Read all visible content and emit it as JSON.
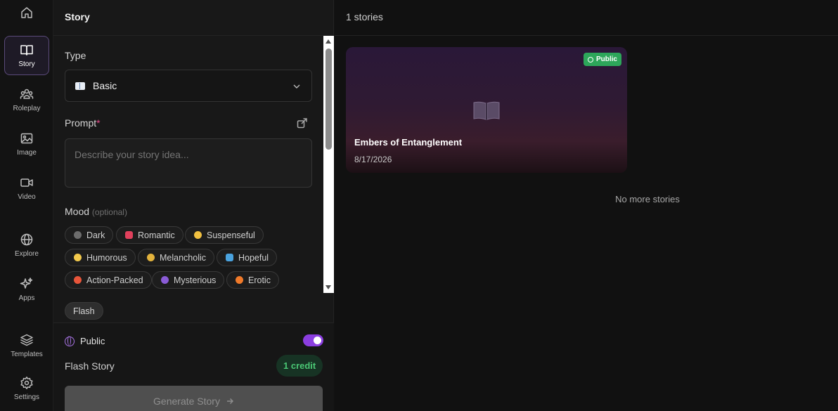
{
  "rail": {
    "items": [
      {
        "label": "Story"
      },
      {
        "label": "Roleplay"
      },
      {
        "label": "Image"
      },
      {
        "label": "Video"
      },
      {
        "label": "Explore"
      },
      {
        "label": "Apps"
      },
      {
        "label": "Templates"
      },
      {
        "label": "Settings"
      }
    ]
  },
  "panel": {
    "title": "Story",
    "type_label": "Type",
    "type_value": "Basic",
    "prompt_label": "Prompt",
    "prompt_required": "*",
    "prompt_placeholder": "Describe your story idea...",
    "mood_label": "Mood",
    "mood_optional": "(optional)",
    "moods": [
      "Dark",
      "Romantic",
      "Suspenseful",
      "Humorous",
      "Melancholic",
      "Hopeful",
      "Action-Packed",
      "Mysterious",
      "Erotic"
    ],
    "flash_chip": "Flash",
    "public_label": "Public",
    "public_on": true,
    "flash_story_label": "Flash Story",
    "credit": "1 credit",
    "generate_label": "Generate Story"
  },
  "main": {
    "count": "1 stories",
    "stories": [
      {
        "title": "Embers of Entanglement",
        "date": "8/17/2026",
        "visibility": "Public"
      }
    ],
    "end_text": "No more stories"
  }
}
